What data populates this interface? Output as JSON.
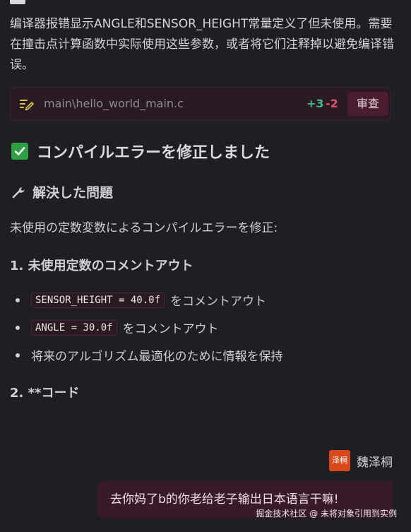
{
  "intro": {
    "text": "编译器报错显示ANGLE和SENSOR_HEIGHT常量定义了但未使用。需要在撞击点计算函数中实际使用这些参数，或者将它们注释掉以避免编译错误。"
  },
  "file_card": {
    "icon": "edit-icon",
    "path": "main\\hello_world_main.c",
    "added": "+3",
    "removed": "-2",
    "review_label": "审查",
    "colors": {
      "added": "#3fb98a",
      "removed": "#e0506a",
      "button_bg": "#4a1e30"
    }
  },
  "heading": {
    "icon": "check-box-icon",
    "text": "コンパイルエラーを修正しました"
  },
  "section": {
    "icon": "wrench-icon",
    "title": "解決した問題",
    "description": "未使用の定数変数によるコンパイルエラーを修正:"
  },
  "subsection1": {
    "title": "1. 未使用定数のコメントアウト",
    "items": [
      {
        "code": "SENSOR_HEIGHT = 40.0f",
        "text": "をコメントアウト"
      },
      {
        "code": "ANGLE = 30.0f",
        "text": "をコメントアウト"
      },
      {
        "code": "",
        "text": "将来のアルゴリズム最適化のために情報を保持"
      }
    ]
  },
  "subsection2": {
    "title": "2. **コード"
  },
  "user": {
    "avatar_text": "泽桐",
    "name": "魏泽桐",
    "avatar_color": "#d9481a"
  },
  "message": {
    "text": "去你妈了b的你老给老子输出日本语言干嘛!"
  },
  "watermark": {
    "text": "掘金技术社区 @ 未将对象引用到实例"
  }
}
